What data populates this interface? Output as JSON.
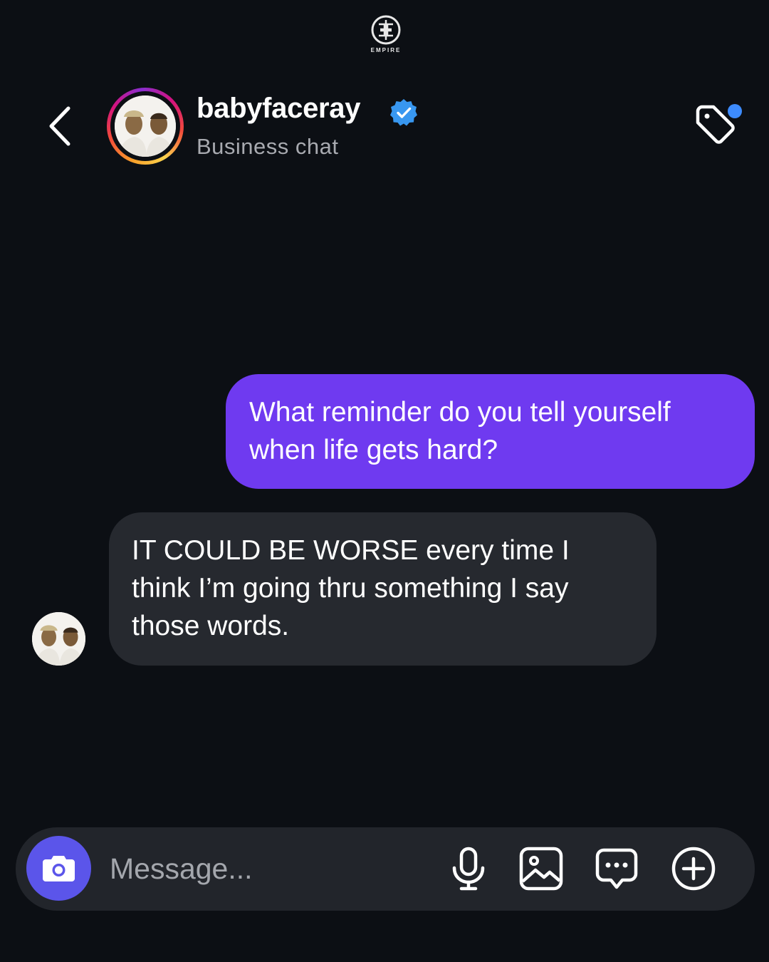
{
  "header": {
    "brand_logo_text": "EMPIRE",
    "username": "babyfaceray",
    "subtitle": "Business chat",
    "icons": {
      "back": "chevron-left-icon",
      "verified": "verified-badge-icon",
      "tag": "tag-icon"
    }
  },
  "messages": [
    {
      "sender": "me",
      "lines": [
        "What reminder do you tell yourself",
        "when life gets hard?"
      ]
    },
    {
      "sender": "babyfaceray",
      "lines": [
        "IT COULD BE WORSE every time I",
        "think I’m going thru something I say",
        "those words."
      ]
    }
  ],
  "composer": {
    "placeholder": "Message...",
    "icons": [
      "camera-icon",
      "microphone-icon",
      "image-icon",
      "chat-bubble-icon",
      "plus-circle-icon"
    ]
  },
  "colors": {
    "background": "#0c0f14",
    "outgoing_bubble": "#6f3af0",
    "incoming_bubble": "#26292f",
    "composer": "#22252b",
    "camera_button": "#5b55ea",
    "verified_blue": "#3897f0",
    "notification_dot": "#3d8bfd"
  }
}
